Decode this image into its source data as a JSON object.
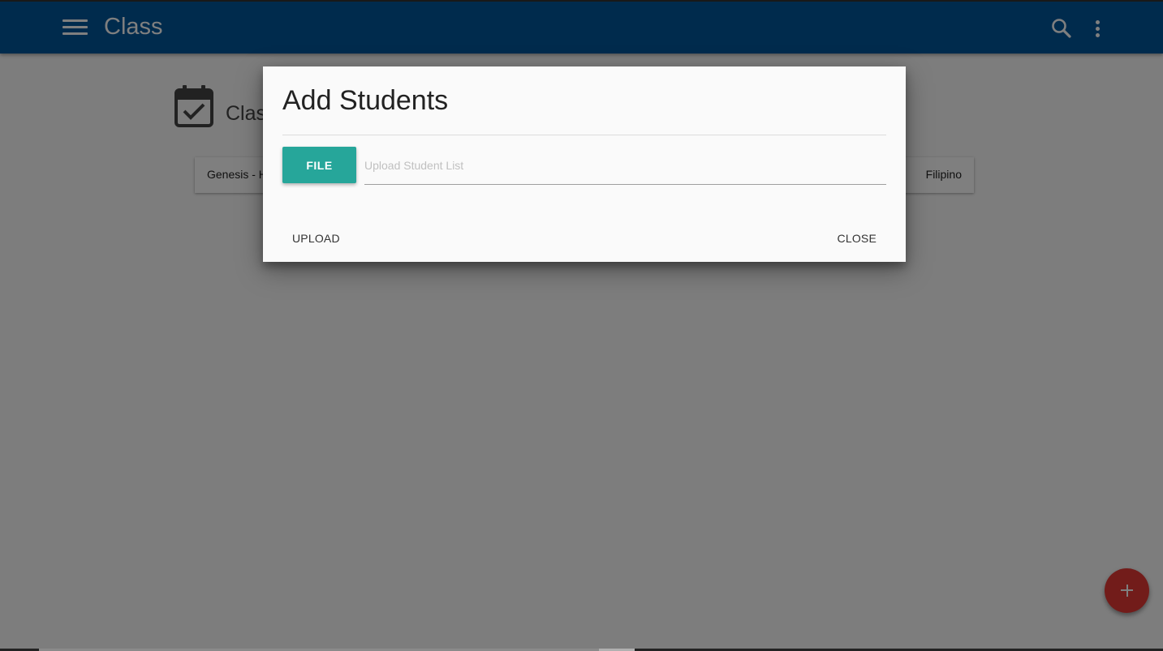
{
  "appbar": {
    "title": "Class",
    "color": "#01579b"
  },
  "background": {
    "section_title": "Class",
    "card": {
      "left_text": "Genesis - H",
      "right_text": "Filipino"
    }
  },
  "dialog": {
    "title": "Add Students",
    "file_button_label": "FILE",
    "file_path_placeholder": "Upload Student List",
    "file_path_value": "",
    "upload_label": "UPLOAD",
    "close_label": "CLOSE",
    "accent_color": "#26a69a"
  },
  "fab": {
    "icon": "plus-icon",
    "color": "#e53935"
  },
  "icons": {
    "menu": "menu-icon",
    "search": "search-icon",
    "more": "more-vert-icon",
    "section": "calendar-check-icon"
  }
}
